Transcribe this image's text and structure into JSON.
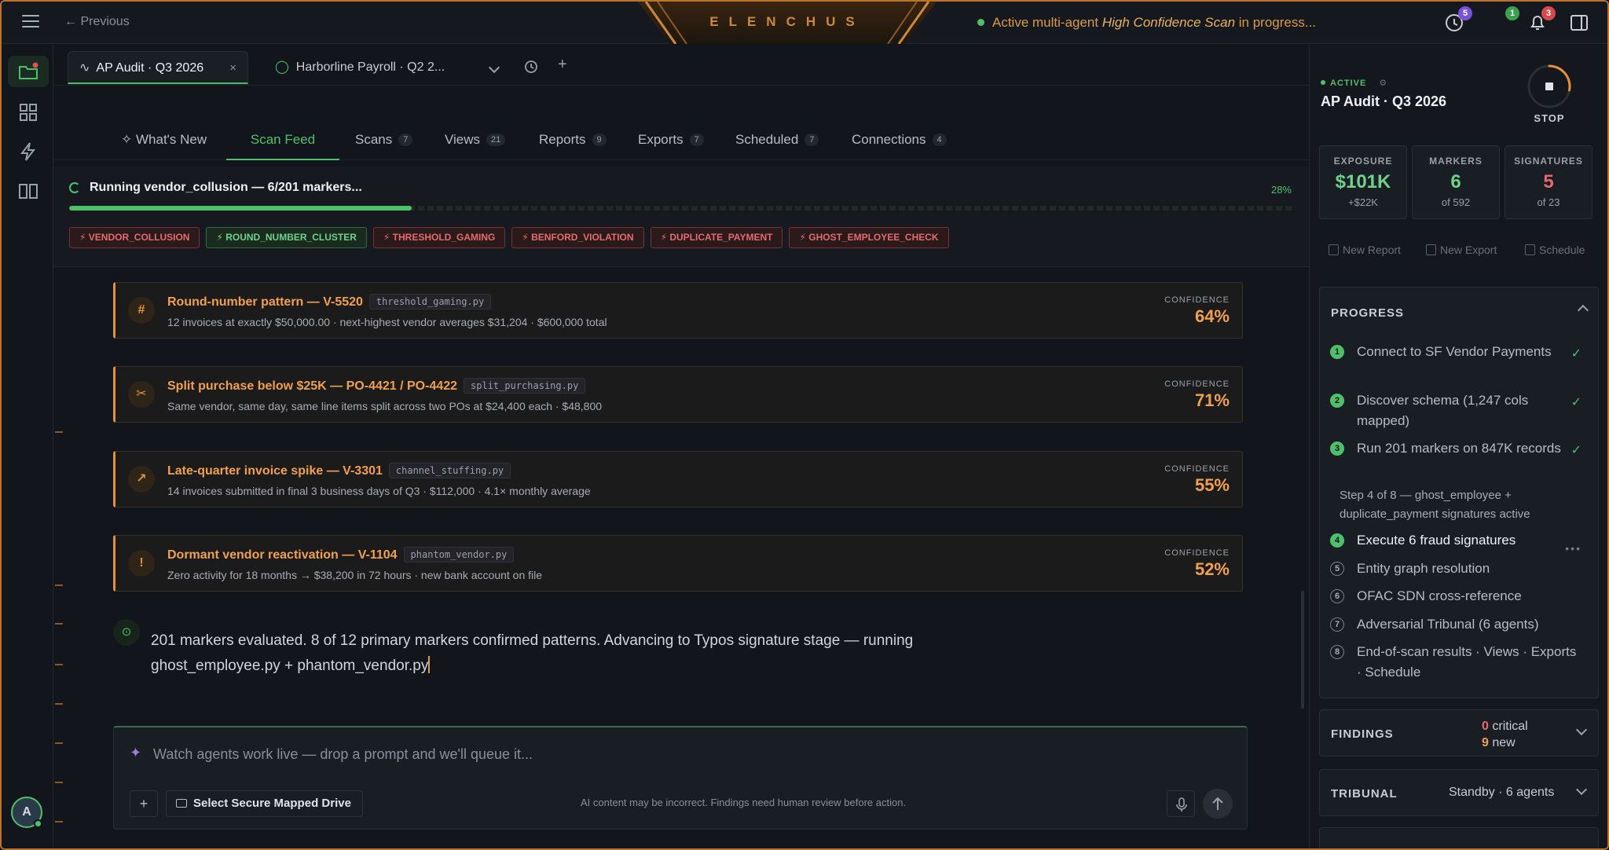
{
  "topbar": {
    "previous_label": "Previous",
    "brand": "ELENCHUS",
    "status_prefix": "Active multi-agent",
    "status_em": "High Confidence Scan",
    "status_suffix": "in progress...",
    "badge_history": "5",
    "badge_agents": "1",
    "badge_notifications": "3"
  },
  "doc_tabs": [
    {
      "label": "AP Audit · Q3 2026",
      "close": "×"
    },
    {
      "label": "Harborline Payroll · Q2 2..."
    }
  ],
  "view_tabs": [
    {
      "label": "What's New",
      "count": ""
    },
    {
      "label": "Scan Feed",
      "count": ""
    },
    {
      "label": "Scans",
      "count": "7"
    },
    {
      "label": "Views",
      "count": "21"
    },
    {
      "label": "Reports",
      "count": "9"
    },
    {
      "label": "Exports",
      "count": "7"
    },
    {
      "label": "Scheduled",
      "count": "7"
    },
    {
      "label": "Connections",
      "count": "4"
    }
  ],
  "running": {
    "title": "Running vendor_collusion — 6/201 markers...",
    "percent_label": "28%",
    "progress": 0.28,
    "chips": [
      {
        "label": "VENDOR_COLLUSION",
        "color": "#e66b6b"
      },
      {
        "label": "ROUND_NUMBER_CLUSTER",
        "color": "#6ed38a"
      },
      {
        "label": "THRESHOLD_GAMING",
        "color": "#e66b6b"
      },
      {
        "label": "BENFORD_VIOLATION",
        "color": "#e66b6b"
      },
      {
        "label": "DUPLICATE_PAYMENT",
        "color": "#e66b6b"
      },
      {
        "label": "GHOST_EMPLOYEE_CHECK",
        "color": "#e66b6b"
      }
    ]
  },
  "findings": [
    {
      "icon": "#",
      "title": "Round-number pattern — V-5520",
      "file": "threshold_gaming.py",
      "sub": "12 invoices at exactly $50,000.00 · next-highest vendor averages $31,204 · $600,000 total",
      "conf_label": "CONFIDENCE",
      "conf": "64%"
    },
    {
      "icon": "✂",
      "title": "Split purchase below $25K — PO-4421 / PO-4422",
      "file": "split_purchasing.py",
      "sub": "Same vendor, same day, same line items split across two POs at $24,400 each · $48,800",
      "conf_label": "CONFIDENCE",
      "conf": "71%"
    },
    {
      "icon": "↗",
      "title": "Late-quarter invoice spike — V-3301",
      "file": "channel_stuffing.py",
      "sub": "14 invoices submitted in final 3 business days of Q3 · $112,000 · 4.1× monthly average",
      "conf_label": "CONFIDENCE",
      "conf": "55%"
    },
    {
      "icon": "!",
      "title": "Dormant vendor reactivation — V-1104",
      "file": "phantom_vendor.py",
      "sub": "Zero activity for 18 months → $38,200 in 72 hours · new bank account on file",
      "conf_label": "CONFIDENCE",
      "conf": "52%"
    }
  ],
  "ai_message": "201 markers evaluated. 8 of 12 primary markers confirmed patterns. Advancing to Typos signature stage — running ghost_employee.py + phantom_vendor.py",
  "composer": {
    "placeholder": "Watch agents work live — drop a prompt and we'll queue it...",
    "plus": "+",
    "drive_label": "Select Secure Mapped Drive",
    "disclaimer": "AI content may be incorrect. Findings need human review before action."
  },
  "sidebar": {
    "status": "ACTIVE",
    "title": "AP Audit · Q3 2026",
    "stop_label": "STOP",
    "stats": [
      {
        "label": "EXPOSURE",
        "value": "$101K",
        "sub": "+$22K",
        "color": "#6ed38a"
      },
      {
        "label": "MARKERS",
        "value": "6",
        "sub": "of 592",
        "color": "#6ed38a"
      },
      {
        "label": "SIGNATURES",
        "value": "5",
        "sub": "of 23",
        "color": "#e66b6b"
      }
    ],
    "actions": [
      "New Report",
      "New Export",
      "Schedule"
    ],
    "progress_title": "PROGRESS",
    "steps": [
      {
        "num": "1",
        "label": "Connect to SF Vendor Payments",
        "done": true
      },
      {
        "num": "2",
        "label": "Discover schema (1,247 cols mapped)",
        "done": true
      },
      {
        "num": "3",
        "label": "Run 201 markers on 847K records",
        "done": true
      },
      {
        "num": "4",
        "label": "Execute 6 fraud signatures",
        "done": false
      },
      {
        "num": "5",
        "label": "Entity graph resolution",
        "done": false
      },
      {
        "num": "6",
        "label": "OFAC SDN cross-reference",
        "done": false
      },
      {
        "num": "7",
        "label": "Adversarial Tribunal (6 agents)",
        "done": false
      },
      {
        "num": "8",
        "label": "End-of-scan results · Views · Exports · Schedule",
        "done": false
      }
    ],
    "substep": "Step 4 of 8 — ghost_employee + duplicate_payment signatures active",
    "findings_panel": {
      "title": "FINDINGS",
      "critical_count": "0",
      "critical_label": "critical",
      "new_count": "9",
      "new_label": "new"
    },
    "tribunal_panel": {
      "title": "TRIBUNAL",
      "status": "Standby · 6 agents"
    }
  }
}
